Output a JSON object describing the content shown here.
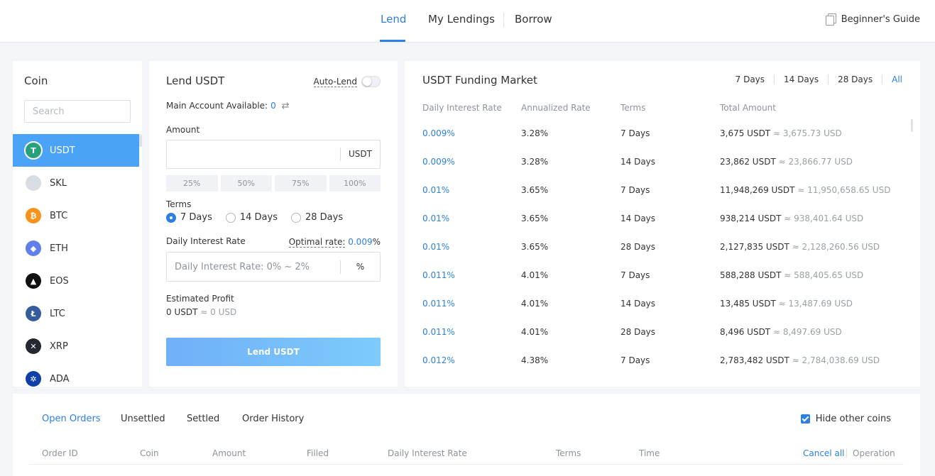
{
  "nav": {
    "tabs": [
      "Lend",
      "My Lendings",
      "Borrow"
    ],
    "guide": "Beginner's Guide"
  },
  "coins": {
    "title": "Coin",
    "search_placeholder": "Search",
    "items": [
      {
        "symbol": "USDT",
        "icon": "usdt-icon",
        "color": "#26a17b",
        "glyph": "T"
      },
      {
        "symbol": "SKL",
        "icon": "skl-icon",
        "color": "#d9dce1",
        "glyph": ""
      },
      {
        "symbol": "BTC",
        "icon": "btc-icon",
        "color": "#f7931a",
        "glyph": "₿"
      },
      {
        "symbol": "ETH",
        "icon": "eth-icon",
        "color": "#627eea",
        "glyph": "◆"
      },
      {
        "symbol": "EOS",
        "icon": "eos-icon",
        "color": "#111111",
        "glyph": "▲"
      },
      {
        "symbol": "LTC",
        "icon": "ltc-icon",
        "color": "#345d9d",
        "glyph": "Ł"
      },
      {
        "symbol": "XRP",
        "icon": "xrp-icon",
        "color": "#23292f",
        "glyph": "✕"
      },
      {
        "symbol": "ADA",
        "icon": "ada-icon",
        "color": "#0d3fa6",
        "glyph": "✲"
      }
    ]
  },
  "lend": {
    "title": "Lend USDT",
    "auto_lend": "Auto-Lend",
    "available_label": "Main Account Available:",
    "available_value": "0",
    "amount_label": "Amount",
    "amount_unit": "USDT",
    "percents": [
      "25%",
      "50%",
      "75%",
      "100%"
    ],
    "terms_label": "Terms",
    "terms": [
      "7 Days",
      "14 Days",
      "28 Days"
    ],
    "selected_term": 0,
    "rate_label": "Daily Interest Rate",
    "optimal_label": "Optimal rate:",
    "optimal_value": "0.009",
    "optimal_suffix": "%",
    "rate_placeholder": "Daily Interest Rate: 0% ~ 2%",
    "rate_unit": "%",
    "profit_label": "Estimated Profit",
    "profit_value": "0 USDT",
    "profit_usd": "≈ 0 USD",
    "button": "Lend USDT"
  },
  "market": {
    "title": "USDT Funding Market",
    "periods": [
      "7 Days",
      "14 Days",
      "28 Days",
      "All"
    ],
    "active_period": 3,
    "headers": [
      "Daily Interest Rate",
      "Annualized Rate",
      "Terms",
      "Total Amount"
    ],
    "rows": [
      {
        "rate": "0.009%",
        "annual": "3.28%",
        "term": "7 Days",
        "amount": "3,675 USDT",
        "usd": "≈ 3,675.73 USD"
      },
      {
        "rate": "0.009%",
        "annual": "3.28%",
        "term": "14 Days",
        "amount": "23,862 USDT",
        "usd": "≈ 23,866.77 USD"
      },
      {
        "rate": "0.01%",
        "annual": "3.65%",
        "term": "7 Days",
        "amount": "11,948,269 USDT",
        "usd": "≈ 11,950,658.65 USD"
      },
      {
        "rate": "0.01%",
        "annual": "3.65%",
        "term": "14 Days",
        "amount": "938,214 USDT",
        "usd": "≈ 938,401.64 USD"
      },
      {
        "rate": "0.01%",
        "annual": "3.65%",
        "term": "28 Days",
        "amount": "2,127,835 USDT",
        "usd": "≈ 2,128,260.56 USD"
      },
      {
        "rate": "0.011%",
        "annual": "4.01%",
        "term": "7 Days",
        "amount": "588,288 USDT",
        "usd": "≈ 588,405.65 USD"
      },
      {
        "rate": "0.011%",
        "annual": "4.01%",
        "term": "14 Days",
        "amount": "13,485 USDT",
        "usd": "≈ 13,487.69 USD"
      },
      {
        "rate": "0.011%",
        "annual": "4.01%",
        "term": "28 Days",
        "amount": "8,496 USDT",
        "usd": "≈ 8,497.69 USD"
      },
      {
        "rate": "0.012%",
        "annual": "4.38%",
        "term": "7 Days",
        "amount": "2,783,482 USDT",
        "usd": "≈ 2,784,038.69 USD"
      }
    ]
  },
  "orders": {
    "tabs": [
      "Open Orders",
      "Unsettled",
      "Settled",
      "Order History"
    ],
    "hide_other": "Hide other coins",
    "headers": [
      "Order ID",
      "Coin",
      "Amount",
      "Filled",
      "Daily Interest Rate",
      "Terms",
      "Time"
    ],
    "cancel_all": "Cancel all",
    "operation": "Operation"
  },
  "colors": {
    "accent": "#2d7fe0",
    "active_coin_bg": "#4aa3f7"
  }
}
